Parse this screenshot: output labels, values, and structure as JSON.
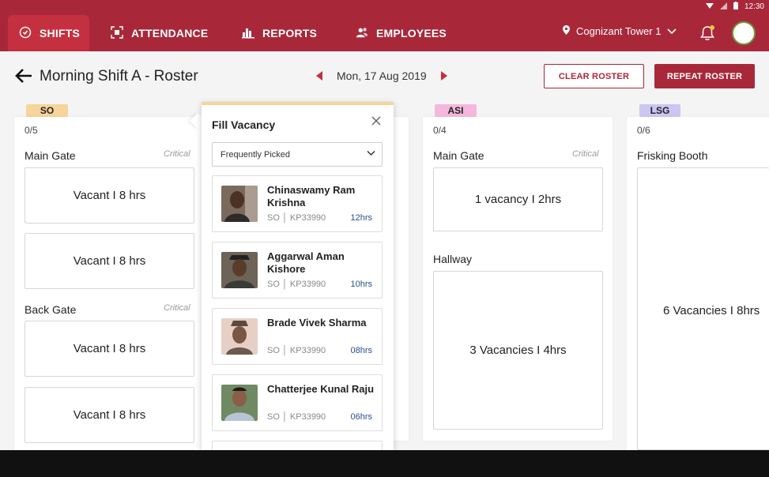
{
  "status": {
    "time": "12:30"
  },
  "nav": {
    "tabs": [
      {
        "label": "SHIFTS"
      },
      {
        "label": "ATTENDANCE"
      },
      {
        "label": "REPORTS"
      },
      {
        "label": "EMPLOYEES"
      }
    ],
    "location": "Cognizant Tower 1"
  },
  "header": {
    "title": "Morning Shift A - Roster",
    "date": "Mon, 17 Aug 2019",
    "clear_label": "CLEAR ROSTER",
    "repeat_label": "REPEAT ROSTER"
  },
  "columns": [
    {
      "badge": "SO",
      "badge_color": "#f6d49a",
      "count": "0/5",
      "posts": [
        {
          "name": "Main Gate",
          "tag": "Critical",
          "slots": [
            "Vacant I 8 hrs",
            "Vacant I 8 hrs"
          ]
        },
        {
          "name": "Back Gate",
          "tag": "Critical",
          "slots": [
            "Vacant I 8 hrs",
            "Vacant I 8 hrs"
          ]
        }
      ]
    },
    {
      "badge": "ASI",
      "badge_color": "#f3b8dc",
      "count": "0/4",
      "posts": [
        {
          "name": "Main Gate",
          "tag": "Critical",
          "slots": [
            "1 vacancy I 2hrs"
          ]
        },
        {
          "name": "Hallway",
          "tag": "",
          "slots": [
            "3 Vacancies I 4hrs"
          ]
        }
      ]
    },
    {
      "badge": "LSG",
      "badge_color": "#cbc6f2",
      "count": "0/6",
      "posts": [
        {
          "name": "Frisking Booth",
          "tag": "",
          "slots": [
            "6 Vacancies I 8hrs"
          ]
        }
      ]
    }
  ],
  "fill_vacancy": {
    "title": "Fill Vacancy",
    "dropdown": "Frequently Picked",
    "employees": [
      {
        "name": "Chinaswamy Ram Krishna",
        "role": "SO",
        "id": "KP33990",
        "hours": "12hrs"
      },
      {
        "name": "Aggarwal Aman Kishore",
        "role": "SO",
        "id": "KP33990",
        "hours": "10hrs"
      },
      {
        "name": "Brade Vivek Sharma",
        "role": "SO",
        "id": "KP33990",
        "hours": "08hrs"
      },
      {
        "name": "Chatterjee Kunal Raju",
        "role": "SO",
        "id": "KP33990",
        "hours": "06hrs"
      }
    ]
  }
}
